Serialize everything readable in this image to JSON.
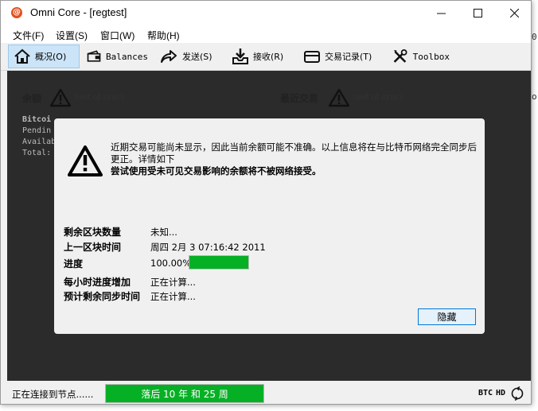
{
  "window": {
    "title": "Omni Core - [regtest]",
    "controls": [
      "minimize",
      "maximize",
      "close"
    ]
  },
  "menu": [
    "文件(F)",
    "设置(S)",
    "窗口(W)",
    "帮助(H)"
  ],
  "toolbar": {
    "items": [
      {
        "label": "概况(O)",
        "icon": "home-icon",
        "active": true
      },
      {
        "label": "Balances",
        "icon": "wallet-icon",
        "active": false
      },
      {
        "label": "发送(S)",
        "icon": "send-arrow-icon",
        "active": false
      },
      {
        "label": "接收(R)",
        "icon": "receive-tray-icon",
        "active": false
      },
      {
        "label": "交易记录(T)",
        "icon": "card-icon",
        "active": false
      },
      {
        "label": "Toolbox",
        "icon": "tools-icon",
        "active": false
      }
    ]
  },
  "overview": {
    "balance_title": "余额",
    "recent_title": "最近交易",
    "sync_note": "(out of sync)",
    "balance_rows": [
      "Bitcoi",
      "Pendin",
      "Availab",
      "Total:"
    ]
  },
  "sync_overlay": {
    "warning_line1": "近期交易可能尚未显示，因此当前余额可能不准确。以上信息将在与比特币网络完全同步后更正。详情如下",
    "warning_line2": "尝试使用受未可见交易影响的余额将不被网络接受。",
    "rows": [
      {
        "label": "剩余区块数量",
        "value": "未知..."
      },
      {
        "label": "上一区块时间",
        "value": "周四 2月 3 07:16:42 2011"
      },
      {
        "label": "进度",
        "value": "100.00%"
      },
      {
        "label": "每小时进度增加",
        "value": "正在计算..."
      },
      {
        "label": "预计剩余同步时间",
        "value": "正在计算..."
      }
    ],
    "progress_fraction": 1.0,
    "hide_button": "隐藏"
  },
  "statusbar": {
    "connecting": "正在连接到节点......",
    "behind": "落后 10 年 和 25 周",
    "unit": "BTC",
    "hd": "HD"
  },
  "colors": {
    "progress_green": "#06b025",
    "main_bg": "#2b2b2b",
    "active_tab": "#cce4f7"
  }
}
